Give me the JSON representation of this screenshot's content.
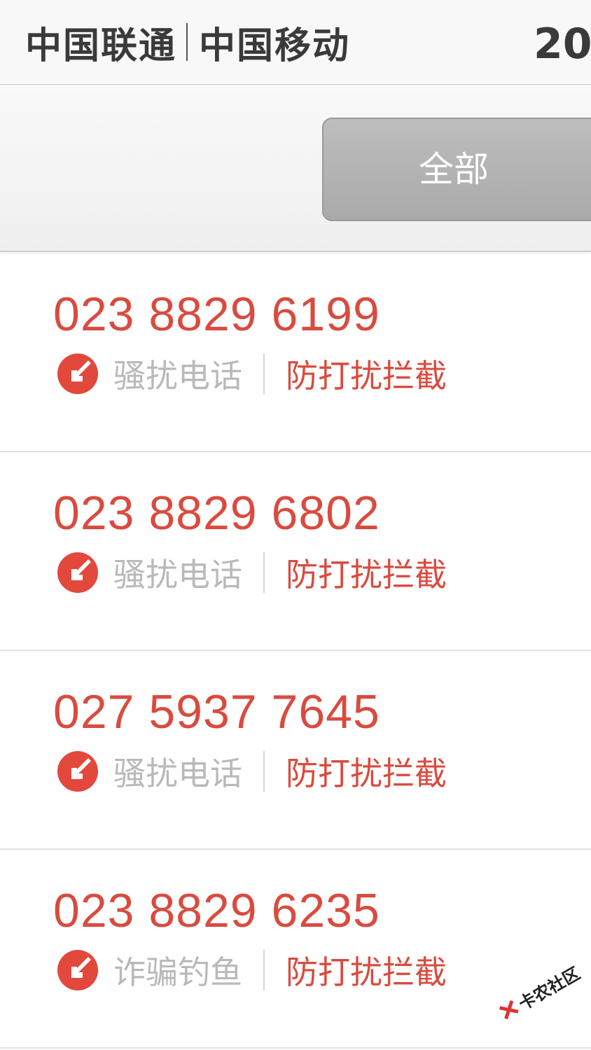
{
  "status_bar": {
    "carrier_1": "中国联通",
    "carrier_2": "中国移动",
    "time": "20:"
  },
  "filter": {
    "active_tab": "全部"
  },
  "calls": [
    {
      "number": "023 8829 6199",
      "category": "骚扰电话",
      "action": "防打扰拦截"
    },
    {
      "number": "023 8829 6802",
      "category": "骚扰电话",
      "action": "防打扰拦截"
    },
    {
      "number": "027 5937 7645",
      "category": "骚扰电话",
      "action": "防打扰拦截"
    },
    {
      "number": "023 8829 6235",
      "category": "诈骗钓鱼",
      "action": "防打扰拦截"
    }
  ],
  "watermark": {
    "text": "卡农社区"
  },
  "colors": {
    "accent_red": "#d94b3f",
    "muted_gray": "#b9b9b9",
    "tab_gray": "#b0b0b0"
  },
  "icons": {
    "tag": "blocked-call-icon"
  }
}
